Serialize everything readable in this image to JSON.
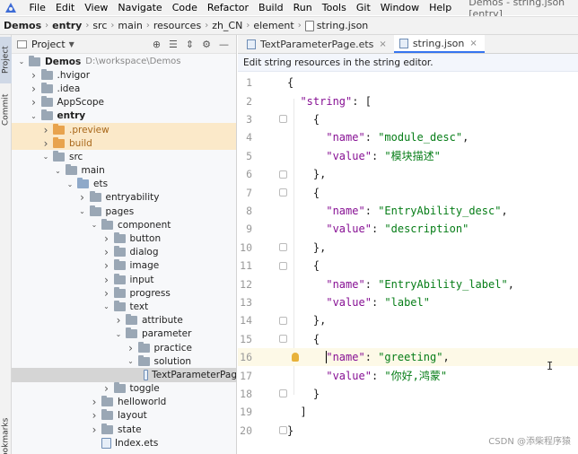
{
  "menubar": {
    "items": [
      "File",
      "Edit",
      "View",
      "Navigate",
      "Code",
      "Refactor",
      "Build",
      "Run",
      "Tools",
      "Git",
      "Window",
      "Help"
    ],
    "window_title": "Demos - string.json [entry]"
  },
  "breadcrumb": [
    "Demos",
    "entry",
    "src",
    "main",
    "resources",
    "zh_CN",
    "element",
    "string.json"
  ],
  "left_strip": {
    "project": "Project",
    "commit": "Commit",
    "bookmarks": "Bookmarks"
  },
  "project_panel": {
    "title": "Project",
    "tree": [
      {
        "label": "Demos",
        "hint": "D:\\workspace\\Demos",
        "depth": 0,
        "expanded": true,
        "kind": "folder"
      },
      {
        "label": ".hvigor",
        "depth": 1,
        "expanded": false,
        "kind": "folder"
      },
      {
        "label": ".idea",
        "depth": 1,
        "expanded": false,
        "kind": "folder"
      },
      {
        "label": "AppScope",
        "depth": 1,
        "expanded": false,
        "kind": "folder"
      },
      {
        "label": "entry",
        "depth": 1,
        "expanded": true,
        "kind": "folder"
      },
      {
        "label": ".preview",
        "depth": 2,
        "expanded": false,
        "kind": "folder-orange"
      },
      {
        "label": "build",
        "depth": 2,
        "expanded": false,
        "kind": "folder-orange"
      },
      {
        "label": "src",
        "depth": 2,
        "expanded": true,
        "kind": "folder"
      },
      {
        "label": "main",
        "depth": 3,
        "expanded": true,
        "kind": "folder"
      },
      {
        "label": "ets",
        "depth": 4,
        "expanded": true,
        "kind": "folder-blue"
      },
      {
        "label": "entryability",
        "depth": 5,
        "expanded": false,
        "kind": "folder"
      },
      {
        "label": "pages",
        "depth": 5,
        "expanded": true,
        "kind": "folder"
      },
      {
        "label": "component",
        "depth": 6,
        "expanded": true,
        "kind": "folder"
      },
      {
        "label": "button",
        "depth": 7,
        "expanded": false,
        "kind": "folder"
      },
      {
        "label": "dialog",
        "depth": 7,
        "expanded": false,
        "kind": "folder"
      },
      {
        "label": "image",
        "depth": 7,
        "expanded": false,
        "kind": "folder"
      },
      {
        "label": "input",
        "depth": 7,
        "expanded": false,
        "kind": "folder"
      },
      {
        "label": "progress",
        "depth": 7,
        "expanded": false,
        "kind": "folder"
      },
      {
        "label": "text",
        "depth": 7,
        "expanded": true,
        "kind": "folder"
      },
      {
        "label": "attribute",
        "depth": 8,
        "expanded": false,
        "kind": "folder"
      },
      {
        "label": "parameter",
        "depth": 8,
        "expanded": true,
        "kind": "folder"
      },
      {
        "label": "practice",
        "depth": 9,
        "expanded": false,
        "kind": "folder"
      },
      {
        "label": "solution",
        "depth": 9,
        "expanded": true,
        "kind": "folder"
      },
      {
        "label": "TextParameterPag",
        "depth": 10,
        "expanded": null,
        "kind": "ets",
        "selected": true
      },
      {
        "label": "toggle",
        "depth": 7,
        "expanded": false,
        "kind": "folder"
      },
      {
        "label": "helloworld",
        "depth": 6,
        "expanded": false,
        "kind": "folder"
      },
      {
        "label": "layout",
        "depth": 6,
        "expanded": false,
        "kind": "folder"
      },
      {
        "label": "state",
        "depth": 6,
        "expanded": false,
        "kind": "folder"
      },
      {
        "label": "Index.ets",
        "depth": 6,
        "expanded": null,
        "kind": "ets"
      }
    ]
  },
  "editor": {
    "tabs": [
      {
        "label": "TextParameterPage.ets",
        "active": false
      },
      {
        "label": "string.json",
        "active": true
      }
    ],
    "banner": "Edit string resources in the string editor.",
    "current_line": 16,
    "lines": [
      {
        "n": "1",
        "text": "{"
      },
      {
        "n": "2",
        "text": "  \"string\": ["
      },
      {
        "n": "3",
        "text": "    {"
      },
      {
        "n": "4",
        "text": "      \"name\": \"module_desc\","
      },
      {
        "n": "5",
        "text": "      \"value\": \"模块描述\""
      },
      {
        "n": "6",
        "text": "    },"
      },
      {
        "n": "7",
        "text": "    {"
      },
      {
        "n": "8",
        "text": "      \"name\": \"EntryAbility_desc\","
      },
      {
        "n": "9",
        "text": "      \"value\": \"description\""
      },
      {
        "n": "10",
        "text": "    },"
      },
      {
        "n": "11",
        "text": "    {"
      },
      {
        "n": "12",
        "text": "      \"name\": \"EntryAbility_label\","
      },
      {
        "n": "13",
        "text": "      \"value\": \"label\""
      },
      {
        "n": "14",
        "text": "    },"
      },
      {
        "n": "15",
        "text": "    {"
      },
      {
        "n": "16",
        "text": "      \"name\": \"greeting\","
      },
      {
        "n": "17",
        "text": "      \"value\": \"你好,鸿蒙\""
      },
      {
        "n": "18",
        "text": "    }"
      },
      {
        "n": "19",
        "text": "  ]"
      },
      {
        "n": "20",
        "text": "}"
      }
    ]
  },
  "watermark": "CSDN @添柴程序猿",
  "colors": {
    "key": "#871094",
    "string": "#067d17",
    "accent": "#3574f0"
  }
}
